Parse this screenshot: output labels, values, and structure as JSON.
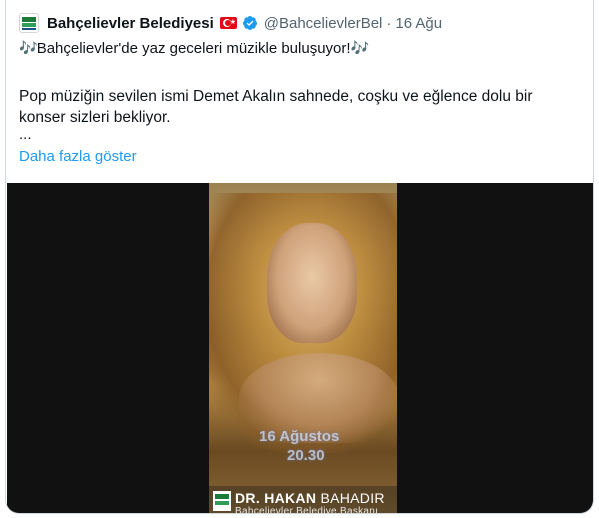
{
  "tweet": {
    "author_name": "Bahçelievler Belediyesi",
    "handle": "@BahcelievlerBel",
    "separator": "·",
    "date": "16 Ağu",
    "headline_note_left": "🎶",
    "headline": "Bahçelievler'de yaz geceleri müzikle buluşuyor!",
    "headline_note_right": "🎶",
    "body": "Pop müziğin sevilen ismi Demet Akalın sahnede, coşku ve eğlence dolu bir konser sizleri bekliyor.",
    "ellipsis": "...",
    "show_more": "Daha fazla göster"
  },
  "video": {
    "overlay_date": "16 Ağustos",
    "overlay_time": "20.30",
    "logo_name_first": "DR. HAKAN",
    "logo_name_last": "BAHADIR",
    "logo_subtitle": "Bahçelievler Belediye Başkanı"
  },
  "colors": {
    "link": "#1d9bf0",
    "verified": "#1d9bf0",
    "muted": "#536471",
    "text": "#0f1419"
  },
  "icons": [
    "avatar-logo",
    "turkish-flag-icon",
    "verified-badge-icon",
    "music-note-icon"
  ]
}
